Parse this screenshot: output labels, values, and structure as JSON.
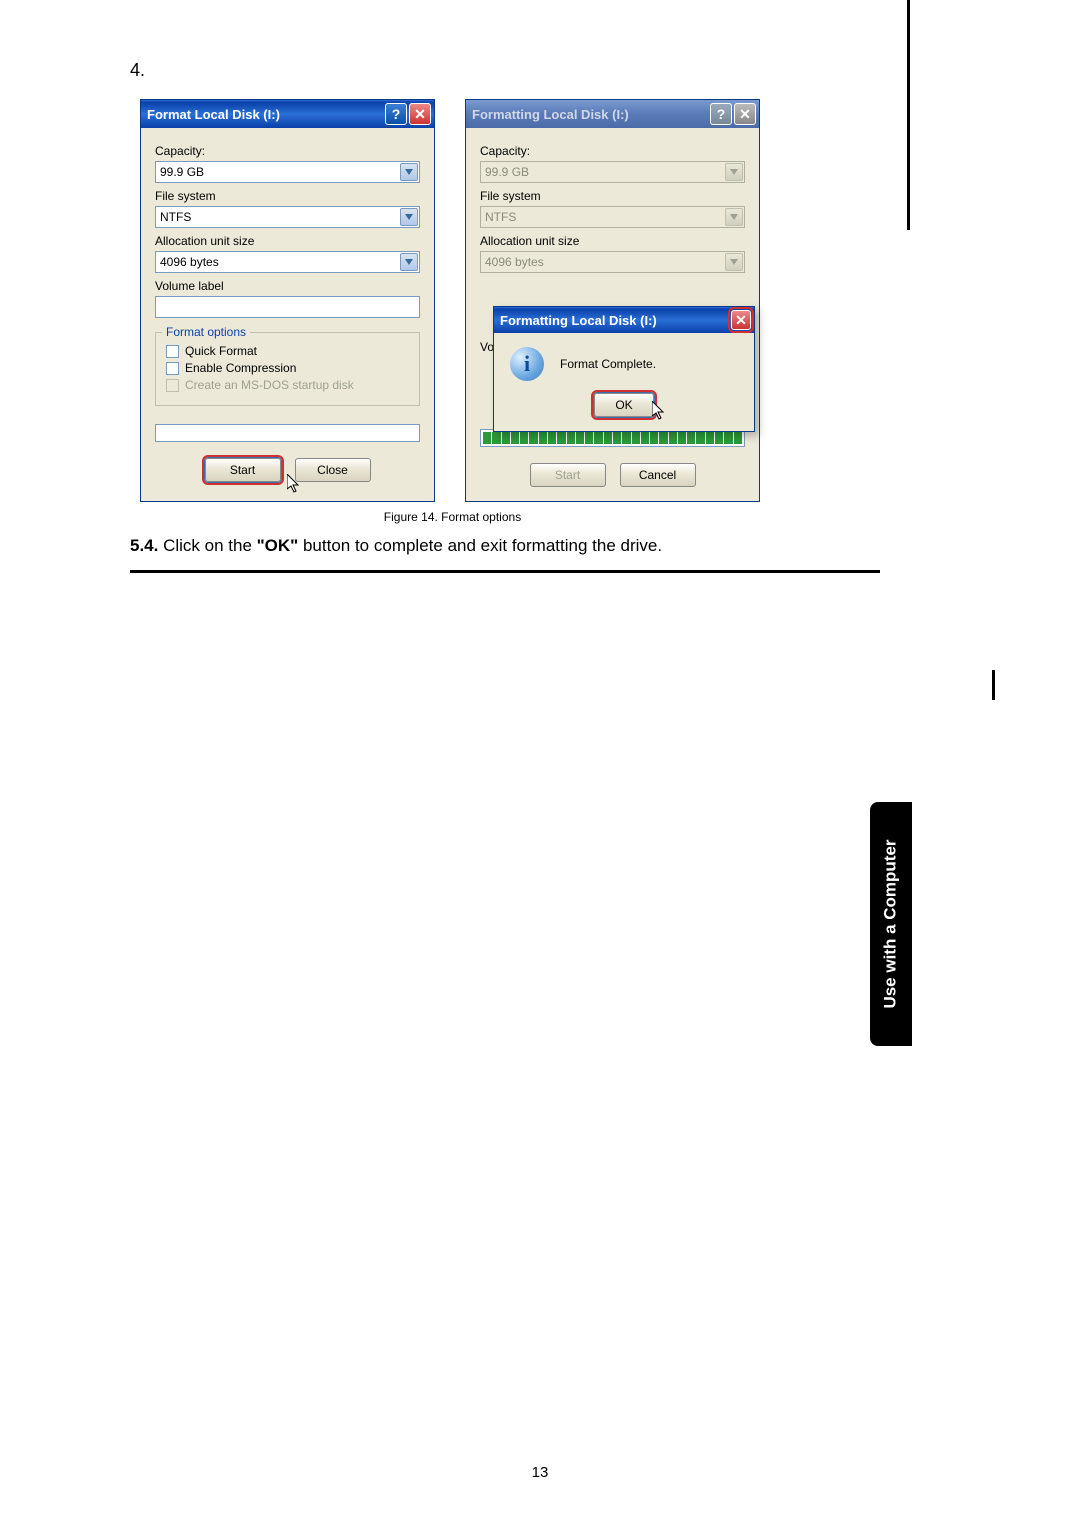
{
  "step_number": "4.",
  "dialog_left": {
    "title": "Format Local Disk (I:)",
    "capacity_label": "Capacity:",
    "capacity_value": "99.9 GB",
    "filesystem_label": "File system",
    "filesystem_value": "NTFS",
    "alloc_label": "Allocation unit size",
    "alloc_value": "4096 bytes",
    "volume_label": "Volume label",
    "group_title": "Format options",
    "opt_quick": "Quick Format",
    "opt_compress": "Enable Compression",
    "opt_msdos": "Create an MS-DOS startup disk",
    "start_btn": "Start",
    "close_btn": "Close"
  },
  "dialog_right": {
    "title": "Formatting Local Disk (I:)",
    "capacity_label": "Capacity:",
    "capacity_value": "99.9 GB",
    "filesystem_label": "File system",
    "filesystem_value": "NTFS",
    "alloc_label": "Allocation unit size",
    "alloc_value": "4096 bytes",
    "vol_label_partial": "Vo",
    "start_btn": "Start",
    "cancel_btn": "Cancel"
  },
  "msgbox": {
    "title": "Formatting Local Disk (I:)",
    "message": "Format Complete.",
    "ok_btn": "OK"
  },
  "figure_caption": "Figure 14. Format options",
  "instruction_prefix": "5.4.",
  "instruction_mid": " Click on the ",
  "instruction_ok": "\"OK\"",
  "instruction_suffix": " button to complete and exit formatting the drive.",
  "side_tab": "Use with a Computer",
  "page_number": "13"
}
